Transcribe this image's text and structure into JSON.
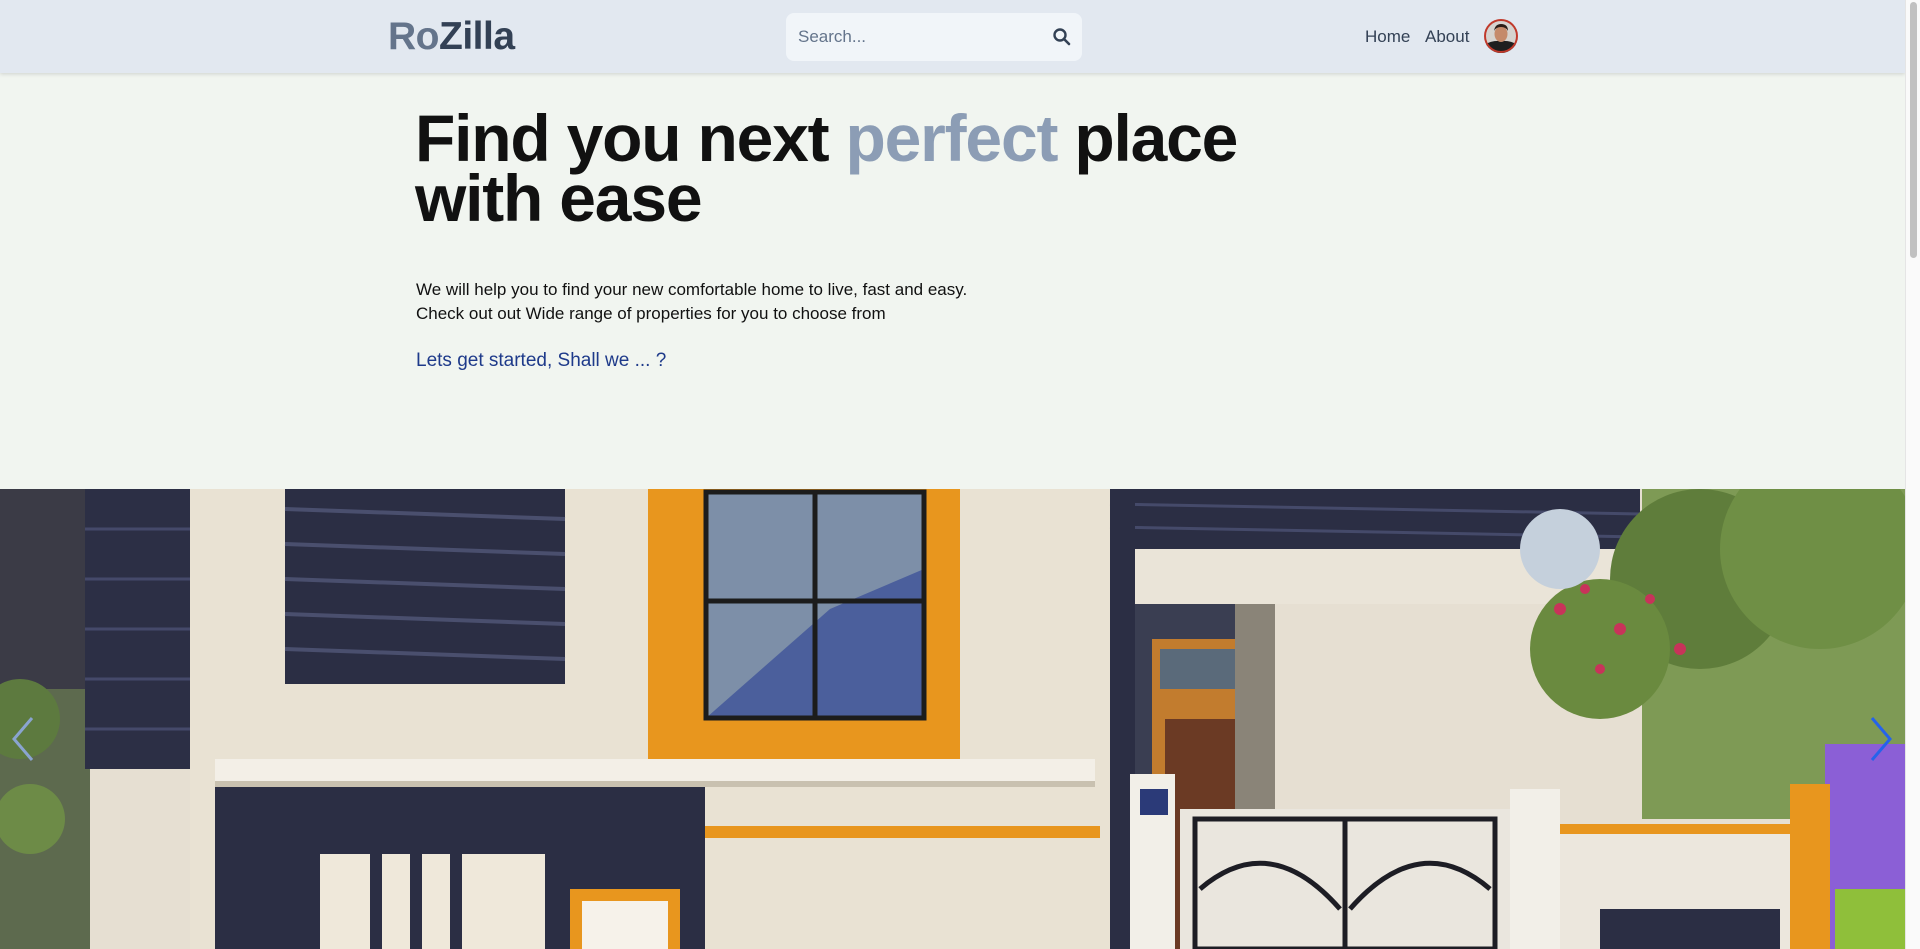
{
  "header": {
    "logo_part1": "Ro",
    "logo_part2": "Zilla",
    "search_placeholder": "Search...",
    "nav": {
      "home": "Home",
      "about": "About"
    }
  },
  "hero": {
    "title_part1": "Find you next ",
    "title_accent": "perfect",
    "title_part2": " place",
    "title_line2": "with ease",
    "desc_line1": "We will help you to find your new comfortable home to live, fast and easy.",
    "desc_line2": "Check out out Wide range of properties for you to choose from",
    "cta": "Lets get started, Shall we ... ?"
  },
  "icons": {
    "search": "search-icon",
    "prev": "chevron-left-icon",
    "next": "chevron-right-icon"
  },
  "colors": {
    "header_bg": "#e2e8f0",
    "page_bg": "#f1f5f0",
    "accent": "#8c9db5",
    "cta": "#1e3a8a",
    "carousel_arrow": "#2563eb"
  }
}
